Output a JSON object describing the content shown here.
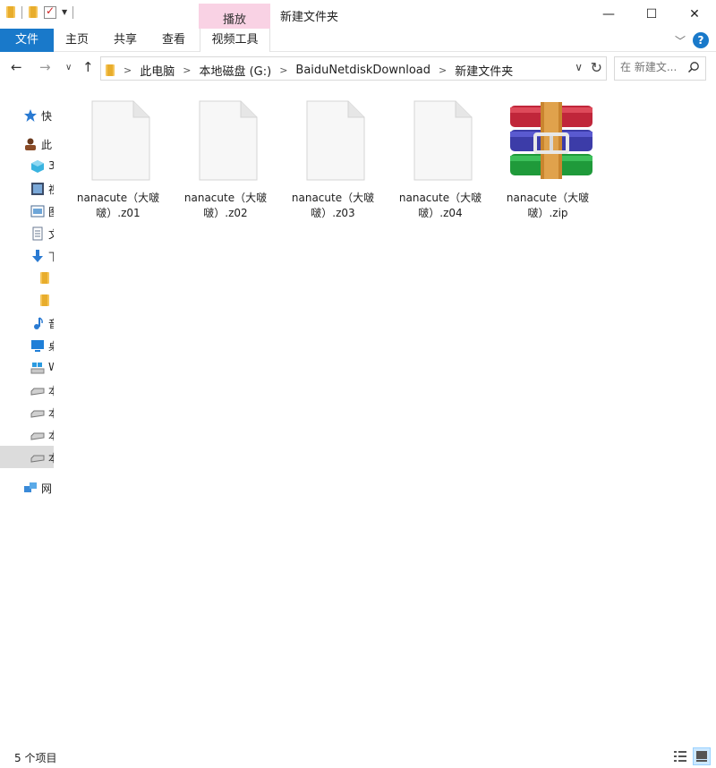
{
  "window": {
    "title": "新建文件夹",
    "contextual_tab": "播放",
    "caption": {
      "minimize": "—",
      "maximize": "☐",
      "close": "✕"
    }
  },
  "ribbon": {
    "tabs": [
      "文件",
      "主页",
      "共享",
      "查看",
      "视频工具"
    ],
    "help": "?"
  },
  "address": {
    "crumbs": [
      "此电脑",
      "本地磁盘 (G:)",
      "BaiduNetdiskDownload",
      "新建文件夹"
    ],
    "search_placeholder": "在 新建文..."
  },
  "sidebar": {
    "items": [
      {
        "label": "快",
        "icon": "star-icon"
      },
      {
        "label": "此",
        "icon": "pc-icon"
      },
      {
        "label": "3",
        "icon": "3d-objects-icon"
      },
      {
        "label": "视",
        "icon": "video-icon"
      },
      {
        "label": "图",
        "icon": "picture-icon"
      },
      {
        "label": "文",
        "icon": "document-icon"
      },
      {
        "label": "下",
        "icon": "download-icon"
      },
      {
        "label": "",
        "icon": "folder-icon"
      },
      {
        "label": "",
        "icon": "folder-icon"
      },
      {
        "label": "音",
        "icon": "music-icon"
      },
      {
        "label": "桌",
        "icon": "desktop-icon"
      },
      {
        "label": "W",
        "icon": "windows-drive-icon"
      },
      {
        "label": "本",
        "icon": "drive-icon"
      },
      {
        "label": "本",
        "icon": "drive-icon"
      },
      {
        "label": "本",
        "icon": "drive-icon"
      },
      {
        "label": "本",
        "icon": "drive-icon"
      },
      {
        "label": "网",
        "icon": "network-icon"
      }
    ]
  },
  "files": [
    {
      "line1": "nanacute（大啵",
      "line2": "啵）.z01",
      "type": "doc"
    },
    {
      "line1": "nanacute（大啵",
      "line2": "啵）.z02",
      "type": "doc"
    },
    {
      "line1": "nanacute（大啵",
      "line2": "啵）.z03",
      "type": "doc"
    },
    {
      "line1": "nanacute（大啵",
      "line2": "啵）.z04",
      "type": "doc"
    },
    {
      "line1": "nanacute（大啵",
      "line2": "啵）.zip",
      "type": "winrar"
    }
  ],
  "status": {
    "item_count": "5 个项目"
  },
  "colors": {
    "accent": "#1979ca",
    "contextual_tab": "#f9d2e4",
    "selected_nav": "#dcdcdc"
  }
}
